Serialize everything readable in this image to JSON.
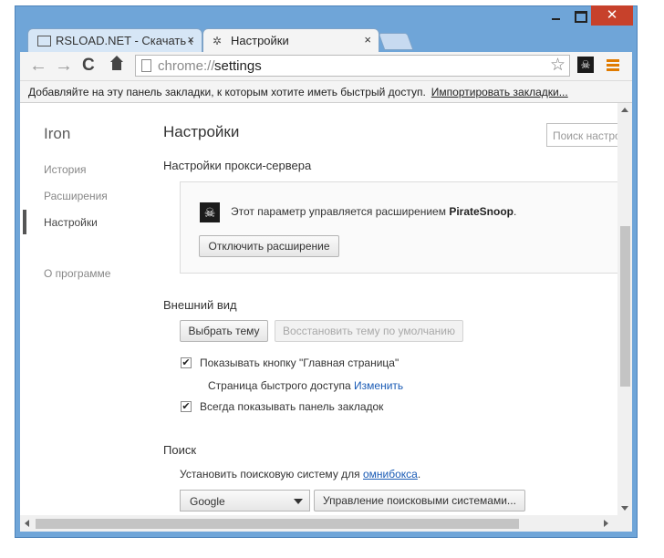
{
  "window": {
    "close_glyph": "✕"
  },
  "tabs": [
    {
      "title": "RSLOAD.NET - Скачать со",
      "close": "×",
      "icon": "page-card-icon"
    },
    {
      "title": "Настройки",
      "close": "×",
      "icon": "gear-icon",
      "icon_glyph": "✲"
    }
  ],
  "toolbar": {
    "back": "←",
    "forward": "→",
    "reload": "C",
    "url_scheme": "chrome://",
    "url_path": "settings",
    "star": "☆",
    "extension_glyph": "☠",
    "extension_name": "PirateSnoop"
  },
  "bookmarks_bar": {
    "prompt": "Добавляйте на эту панель закладки, к которым хотите иметь быстрый доступ.",
    "import_link": "Импортировать закладки..."
  },
  "sidebar": {
    "brand": "Iron",
    "items": [
      {
        "label": "История"
      },
      {
        "label": "Расширения"
      },
      {
        "label": "Настройки",
        "active": true
      },
      {
        "label": "О программе"
      }
    ]
  },
  "main": {
    "title": "Настройки",
    "search_placeholder": "Поиск настроек",
    "proxy": {
      "title": "Настройки прокси-сервера",
      "icon_glyph": "☠",
      "text_prefix": "Этот параметр управляется расширением",
      "extension": "PirateSnoop",
      "text_suffix": ".",
      "disable_button": "Отключить расширение"
    },
    "appearance": {
      "title": "Внешний вид",
      "choose_theme": "Выбрать тему",
      "reset_theme": "Восстановить тему по умолчанию",
      "show_home": {
        "label": "Показывать кнопку \"Главная страница\"",
        "checked": true,
        "mark": "✔"
      },
      "quick_access_label": "Страница быстрого доступа",
      "change_link": "Изменить",
      "show_bookmarks": {
        "label": "Всегда показывать панель закладок",
        "checked": true,
        "mark": "✔"
      }
    },
    "search": {
      "title": "Поиск",
      "text_prefix": "Установить поисковую систему для",
      "omnibox_link": "омнибокса",
      "text_suffix": ".",
      "engine": "Google",
      "manage_button": "Управление поисковыми системами..."
    }
  }
}
